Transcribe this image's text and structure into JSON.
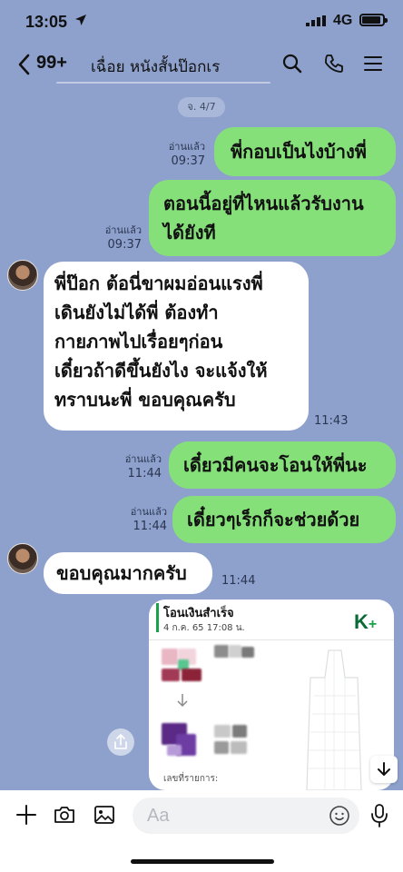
{
  "status_bar": {
    "time": "13:05",
    "network": "4G"
  },
  "header": {
    "unread_count": "99+",
    "title": "เฉื่อย หนังสั้นป๊อกเร"
  },
  "date_separator": "จ. 4/7",
  "messages": [
    {
      "side": "out",
      "text": "พี่กอบเป็นไงบ้างพี่",
      "read": "อ่านแล้ว",
      "time": "09:37"
    },
    {
      "side": "out",
      "lines": [
        "ตอนนี้อยู่ที่ไหนแล้วรับงาน",
        "ได้ยังที"
      ],
      "read": "อ่านแล้ว",
      "time": "09:37"
    },
    {
      "side": "in",
      "lines": [
        "พี่ป๊อก ต้อนี่ขาผมอ่อนแรงพี่",
        "เดินยังไม่ได้พี่ ต้องทำ",
        "กายภาพไปเรื่อยๆก่อน",
        "เดี๋ยวถ้าดีขึ้นยังไง จะแจ้งให้",
        "ทราบนะพี่ ขอบคุณครับ"
      ],
      "time": "11:43"
    },
    {
      "side": "out",
      "text": "เดี๋ยวมีคนจะโอนให้พี่นะ",
      "read": "อ่านแล้ว",
      "time": "11:44"
    },
    {
      "side": "out",
      "text": "เดี๋ยวๆเร็กก็จะช่วยด้วย",
      "read": "อ่านแล้ว",
      "time": "11:44"
    },
    {
      "side": "in",
      "text": "ขอบคุณมากครับ",
      "time": "11:44"
    }
  ],
  "transfer_card": {
    "title": "โอนเงินสำเร็จ",
    "datetime": "4 ก.ค. 65  17:08 น.",
    "brand": "K",
    "brand_plus": "+",
    "ref_label": "เลขที่รายการ:"
  },
  "composer": {
    "placeholder": "Aa"
  },
  "colors": {
    "chat_bg": "#8da1cc",
    "outgoing": "#86e07a",
    "incoming": "#ffffff",
    "brand_green": "#18a348"
  },
  "icons": [
    "location-arrow-icon",
    "signal-icon",
    "battery-icon",
    "back-chevron-icon",
    "search-icon",
    "phone-icon",
    "menu-icon",
    "share-icon",
    "arrow-down-icon",
    "plus-icon",
    "camera-icon",
    "image-icon",
    "emoji-icon",
    "mic-icon"
  ]
}
